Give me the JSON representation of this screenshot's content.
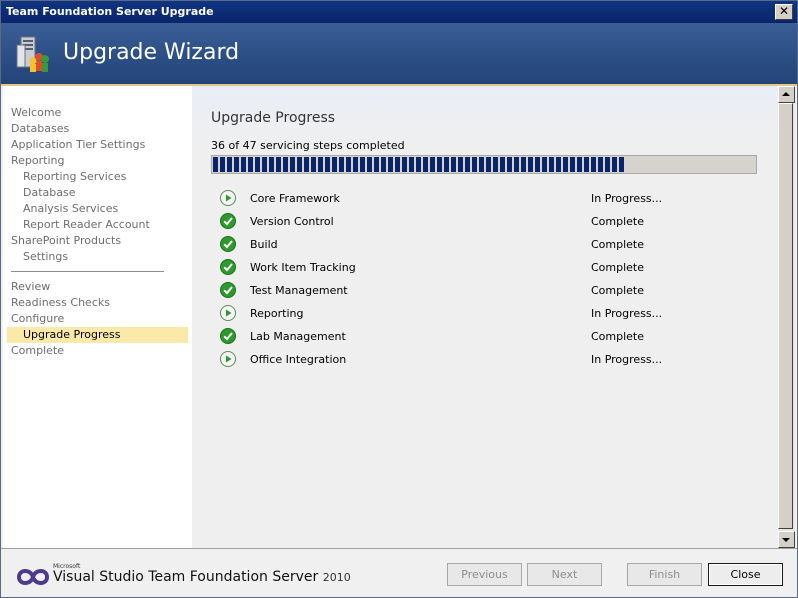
{
  "window": {
    "title": "Team Foundation Server Upgrade"
  },
  "banner": {
    "title": "Upgrade Wizard"
  },
  "sidebar": {
    "items": [
      {
        "label": "Welcome",
        "level": 0
      },
      {
        "label": "Databases",
        "level": 0
      },
      {
        "label": "Application Tier Settings",
        "level": 0
      },
      {
        "label": "Reporting",
        "level": 0
      },
      {
        "label": "Reporting Services",
        "level": 1
      },
      {
        "label": "Database",
        "level": 1
      },
      {
        "label": "Analysis Services",
        "level": 1
      },
      {
        "label": "Report Reader Account",
        "level": 1
      },
      {
        "label": "SharePoint Products",
        "level": 0
      },
      {
        "label": "Settings",
        "level": 1
      },
      {
        "label": "Review",
        "level": 0
      },
      {
        "label": "Readiness Checks",
        "level": 0
      },
      {
        "label": "Configure",
        "level": 0
      },
      {
        "label": "Upgrade Progress",
        "level": 1,
        "active": true
      },
      {
        "label": "Complete",
        "level": 0
      }
    ]
  },
  "main": {
    "section_title": "Upgrade Progress",
    "steps_text": "36 of 47 servicing steps completed",
    "progress": {
      "completed": 36,
      "total": 47
    },
    "tasks": [
      {
        "name": "Core Framework",
        "status": "In Progress...",
        "icon": "in-progress-icon"
      },
      {
        "name": "Version Control",
        "status": "Complete",
        "icon": "complete-check-icon"
      },
      {
        "name": "Build",
        "status": "Complete",
        "icon": "complete-check-icon"
      },
      {
        "name": "Work Item Tracking",
        "status": "Complete",
        "icon": "complete-check-icon"
      },
      {
        "name": "Test Management",
        "status": "Complete",
        "icon": "complete-check-icon"
      },
      {
        "name": "Reporting",
        "status": "In Progress...",
        "icon": "in-progress-icon"
      },
      {
        "name": "Lab Management",
        "status": "Complete",
        "icon": "complete-check-icon"
      },
      {
        "name": "Office Integration",
        "status": "In Progress...",
        "icon": "in-progress-icon"
      }
    ]
  },
  "footer": {
    "brand_microsoft": "Microsoft",
    "brand_product": "Visual Studio Team Foundation Server",
    "brand_year": "2010",
    "buttons": {
      "previous": "Previous",
      "next": "Next",
      "finish": "Finish",
      "close": "Close"
    }
  },
  "colors": {
    "titlebar": "#0a246a",
    "banner": "#2a4d84",
    "progress_fill": "#0a246a",
    "active_item": "#fbe9a9",
    "complete_green": "#2e9a2e"
  }
}
